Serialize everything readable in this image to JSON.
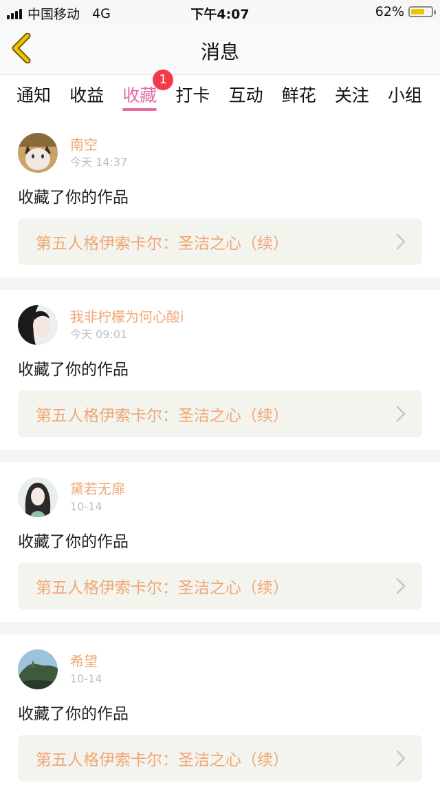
{
  "status": {
    "carrier": "中国移动",
    "network": "4G",
    "time": "下午4:07",
    "battery": "62%"
  },
  "nav": {
    "title": "消息"
  },
  "tabs": [
    {
      "label": "通知"
    },
    {
      "label": "收益"
    },
    {
      "label": "收藏",
      "badge": "1",
      "active": true
    },
    {
      "label": "打卡"
    },
    {
      "label": "互动"
    },
    {
      "label": "鲜花"
    },
    {
      "label": "关注"
    },
    {
      "label": "小组"
    }
  ],
  "items": [
    {
      "user": "南空",
      "time": "今天 14:37",
      "action": "收藏了你的作品",
      "work": "第五人格伊索卡尔：圣洁之心（续）"
    },
    {
      "user": "我非柠檬为何心酸i",
      "time": "今天 09:01",
      "action": "收藏了你的作品",
      "work": "第五人格伊索卡尔：圣洁之心（续）"
    },
    {
      "user": "黛若无扉",
      "time": "10-14",
      "action": "收藏了你的作品",
      "work": "第五人格伊索卡尔：圣洁之心（续）"
    },
    {
      "user": "希望",
      "time": "10-14",
      "action": "收藏了你的作品",
      "work": "第五人格伊索卡尔：圣洁之心（续）"
    }
  ],
  "colors": {
    "accent": "#e36ca2",
    "name": "#f0a775",
    "badge": "#f33a4a",
    "back": "#e6b400"
  }
}
